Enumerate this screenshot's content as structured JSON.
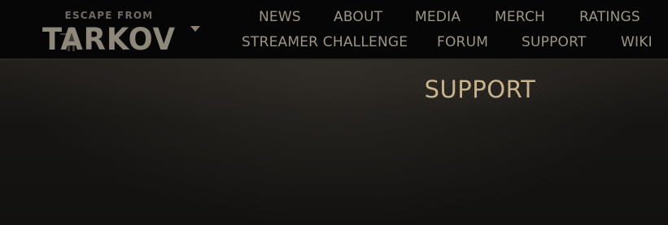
{
  "logo": {
    "line1": "ESCAPE FROM",
    "line2": "TARKOV",
    "menu_icon": "chevron-down-icon"
  },
  "nav": {
    "row1": [
      "NEWS",
      "ABOUT",
      "MEDIA",
      "MERCH",
      "RATINGS"
    ],
    "row2": [
      "STREAMER CHALLENGE",
      "FORUM",
      "SUPPORT",
      "WIKI"
    ]
  },
  "page": {
    "title": "SUPPORT"
  },
  "colors": {
    "header_bg": "#060606",
    "nav_text": "#9c9584",
    "title_text": "#c9b38a",
    "content_bg": "#141312"
  }
}
